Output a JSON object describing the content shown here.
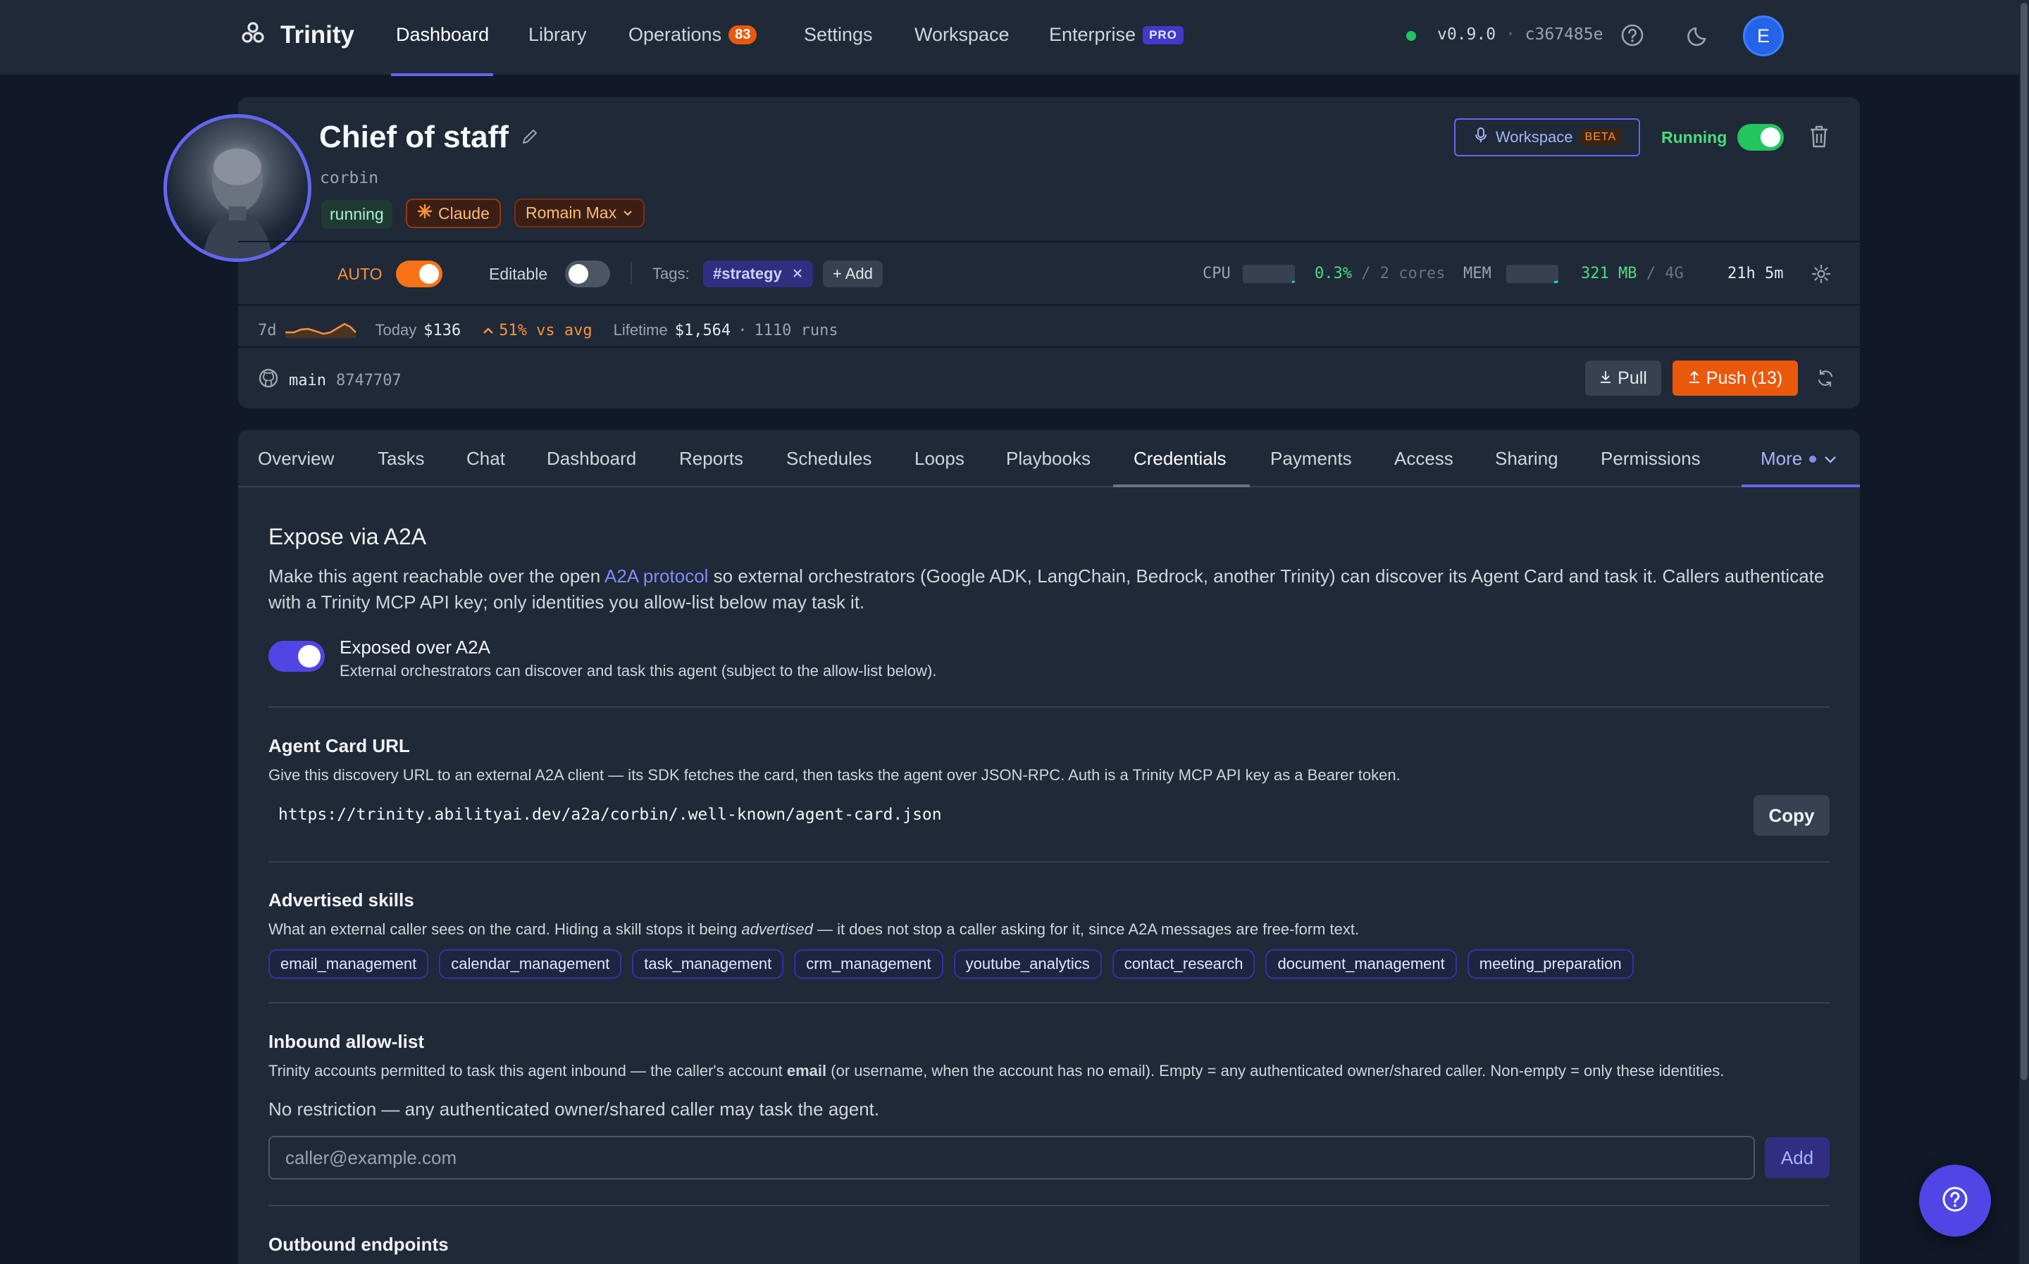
{
  "nav": {
    "brand": "Trinity",
    "items": [
      {
        "label": "Dashboard",
        "active": true
      },
      {
        "label": "Library"
      },
      {
        "label": "Operations",
        "badge": "83"
      },
      {
        "label": "Settings"
      },
      {
        "label": "Workspace"
      },
      {
        "label": "Enterprise",
        "badge": "PRO"
      }
    ],
    "version": "v0.9.0",
    "version_sep": "·",
    "commit": "c367485e",
    "user_initial": "E",
    "status_color": "#22c55e"
  },
  "agent": {
    "name": "Chief of staff",
    "username": "corbin",
    "status_pill": "running",
    "model": "Claude",
    "model_variant": "Romain Max",
    "workspace_button": "Workspace",
    "workspace_badge": "BETA",
    "running_label": "Running",
    "running_on": true,
    "auto_label": "AUTO",
    "auto_on": true,
    "editable_label": "Editable",
    "editable_on": false,
    "tags_label": "Tags:",
    "tags": [
      "#strategy"
    ],
    "add_tag": "+ Add",
    "cpu_label": "CPU",
    "cpu_value": "0.3%",
    "cpu_total": "/ 2 cores",
    "cpu_usage_fraction": 0.003,
    "mem_label": "MEM",
    "mem_value": "321 MB",
    "mem_total": "/ 4G",
    "mem_usage_fraction": 0.08,
    "uptime": "21h 5m"
  },
  "cost": {
    "period": "7d",
    "today_label": "Today",
    "today_value": "$136",
    "vs_avg": "51% vs avg",
    "lifetime_label": "Lifetime",
    "lifetime_value": "$1,564",
    "sep": "·",
    "runs": "1110 runs"
  },
  "git": {
    "branch": "main",
    "commit": "8747707",
    "pull_label": "Pull",
    "push_label": "Push (13)"
  },
  "tabs": {
    "items": [
      "Overview",
      "Tasks",
      "Chat",
      "Dashboard",
      "Reports",
      "Schedules",
      "Loops",
      "Playbooks",
      "Credentials",
      "Payments",
      "Access",
      "Sharing",
      "Permissions"
    ],
    "active": "Credentials",
    "more": "More"
  },
  "a2a": {
    "title": "Expose via A2A",
    "intro_pre": "Make this agent reachable over the open ",
    "intro_link": "A2A protocol",
    "intro_post": " so external orchestrators (Google ADK, LangChain, Bedrock, another Trinity) can discover its Agent Card and task it. Callers authenticate with a Trinity MCP API key; only identities you allow-list below may task it.",
    "exposed_title": "Exposed over A2A",
    "exposed_desc": "External orchestrators can discover and task this agent (subject to the allow-list below).",
    "exposed_on": true,
    "card_url_title": "Agent Card URL",
    "card_url_desc": "Give this discovery URL to an external A2A client — its SDK fetches the card, then tasks the agent over JSON-RPC. Auth is a Trinity MCP API key as a Bearer token.",
    "card_url": "https://trinity.abilityai.dev/a2a/corbin/.well-known/agent-card.json",
    "copy_label": "Copy",
    "skills_title": "Advertised skills",
    "skills_desc_pre": "What an external caller sees on the card. Hiding a skill stops it being ",
    "skills_desc_em": "advertised",
    "skills_desc_post": " — it does not stop a caller asking for it, since A2A messages are free-form text.",
    "skills": [
      "email_management",
      "calendar_management",
      "task_management",
      "crm_management",
      "youtube_analytics",
      "contact_research",
      "document_management",
      "meeting_preparation"
    ],
    "allow_title": "Inbound allow-list",
    "allow_desc_pre": "Trinity accounts permitted to task this agent inbound — the caller's account ",
    "allow_desc_strong": "email",
    "allow_desc_post": " (or username, when the account has no email). Empty = any authenticated owner/shared caller. Non-empty = only these identities.",
    "no_restriction": "No restriction — any authenticated owner/shared caller may task the agent.",
    "input_placeholder": "caller@example.com",
    "input_value": "",
    "add_label": "Add",
    "outbound_title": "Outbound endpoints"
  },
  "colors": {
    "accent": "#6366f1",
    "orange": "#ea580c",
    "green": "#22c55e",
    "background": "#111827",
    "surface": "#1f2937"
  }
}
